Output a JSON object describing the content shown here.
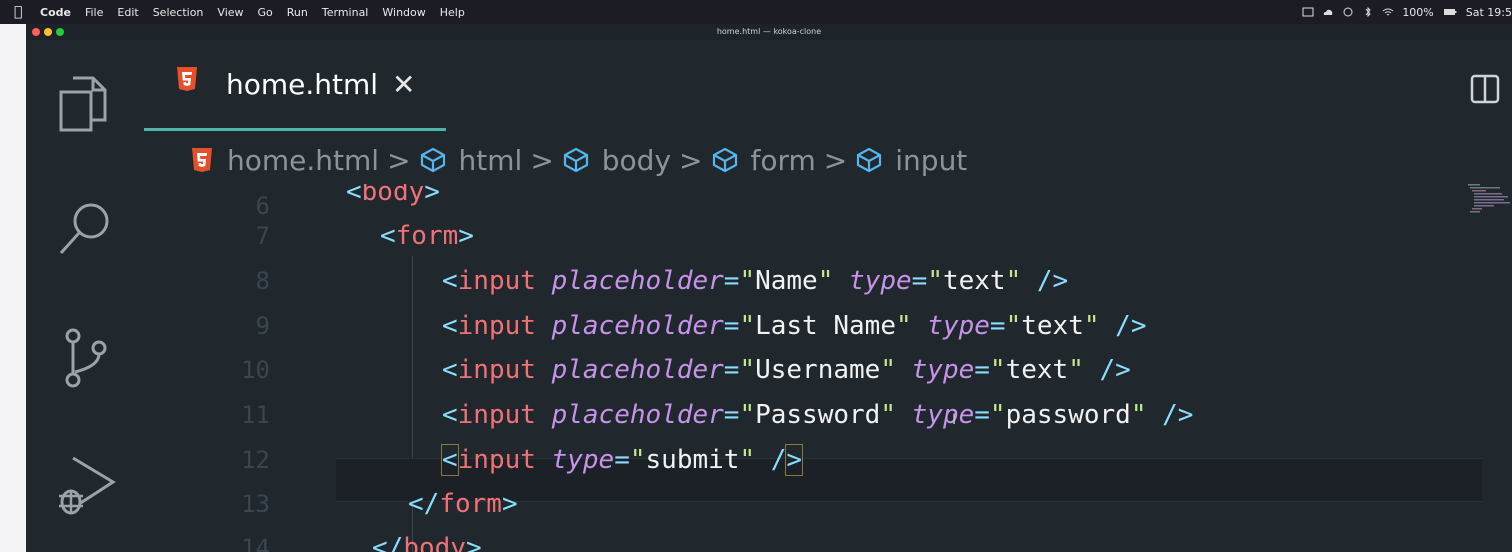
{
  "menubar": {
    "items": [
      "Code",
      "File",
      "Edit",
      "Selection",
      "View",
      "Go",
      "Run",
      "Terminal",
      "Window",
      "Help"
    ],
    "battery": "100%",
    "clock": "Sat 19:5"
  },
  "window": {
    "title": "home.html — kokoa-clone"
  },
  "tab": {
    "label": "home.html",
    "close": "✕"
  },
  "breadcrumb": {
    "file": "home.html",
    "parts": [
      "html",
      "body",
      "form",
      "input"
    ]
  },
  "editor": {
    "line_numbers": [
      "6",
      "7",
      "8",
      "9",
      "10",
      "11",
      "12",
      "13",
      "14"
    ],
    "current_line": "12",
    "strings": {
      "body": "body",
      "form": "form",
      "input": "input",
      "placeholder": "placeholder",
      "type": "type",
      "name": "Name",
      "last_name": "Last Name",
      "username": "Username",
      "password_ph": "Password",
      "text": "text",
      "password": "password",
      "submit": "submit"
    }
  },
  "colors": {
    "tag": "#f07178",
    "bracket": "#89ddff",
    "attribute": "#c792ea",
    "string_quote": "#c3e88d",
    "accent": "#4db6ac",
    "html5_icon": "#e4502a",
    "cube_icon": "#55b6ee"
  },
  "icons": {
    "activity": [
      "explorer-icon",
      "search-icon",
      "source-control-icon",
      "run-debug-icon"
    ],
    "split": "split-editor-icon"
  }
}
